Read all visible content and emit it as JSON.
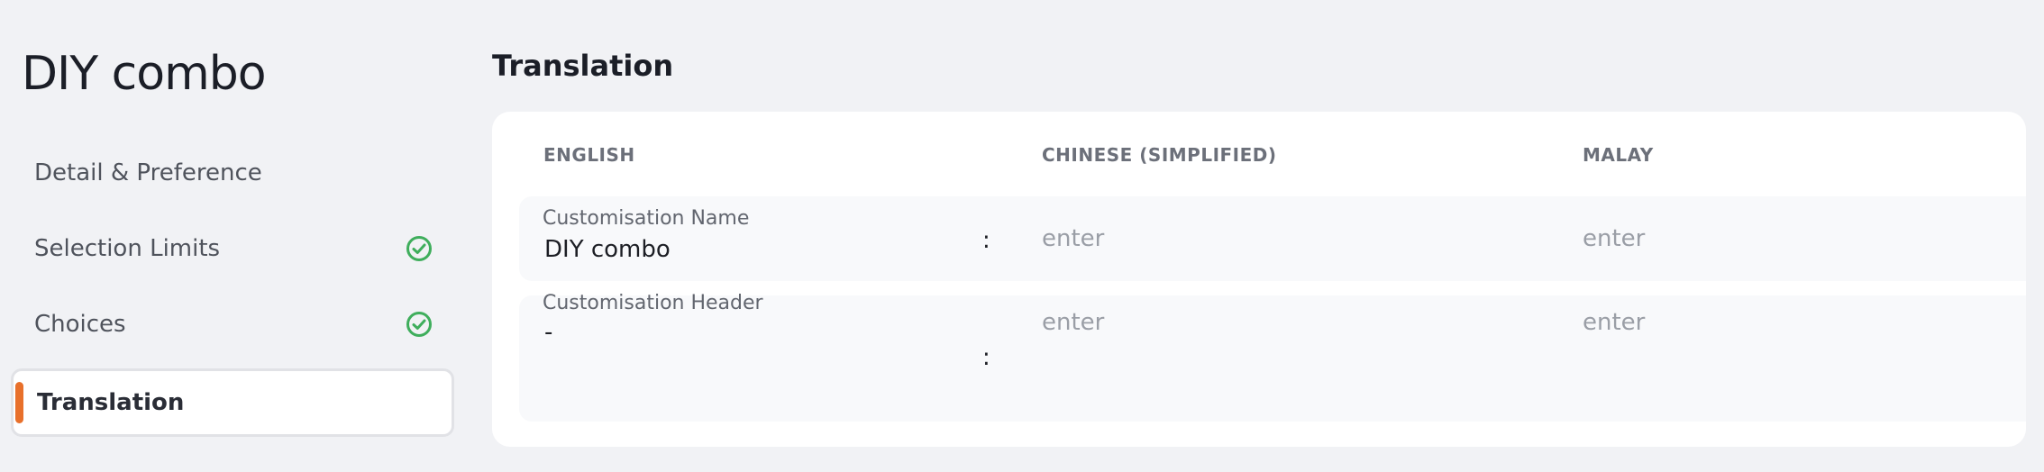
{
  "page": {
    "title": "DIY combo"
  },
  "sidebar": {
    "items": [
      {
        "label": "Detail & Preference",
        "completed": false
      },
      {
        "label": "Selection Limits",
        "completed": true
      },
      {
        "label": "Choices",
        "completed": true
      },
      {
        "label": "Translation",
        "completed": false,
        "active": true
      }
    ]
  },
  "main": {
    "section_title": "Translation",
    "columns": [
      "ENGLISH",
      "CHINESE (SIMPLIFIED)",
      "MALAY"
    ],
    "rows": [
      {
        "label": "Customisation Name",
        "english": "DIY combo",
        "separator": ":",
        "chinese_placeholder": "enter",
        "malay_placeholder": "enter"
      },
      {
        "label": "Customisation Header",
        "english": "-",
        "separator": ":",
        "chinese_placeholder": "enter",
        "malay_placeholder": "enter"
      }
    ]
  },
  "colors": {
    "accent": "#e8702b",
    "success": "#3fae5c",
    "background": "#f1f2f5"
  },
  "icons": {
    "completed": "check-circle-icon"
  }
}
